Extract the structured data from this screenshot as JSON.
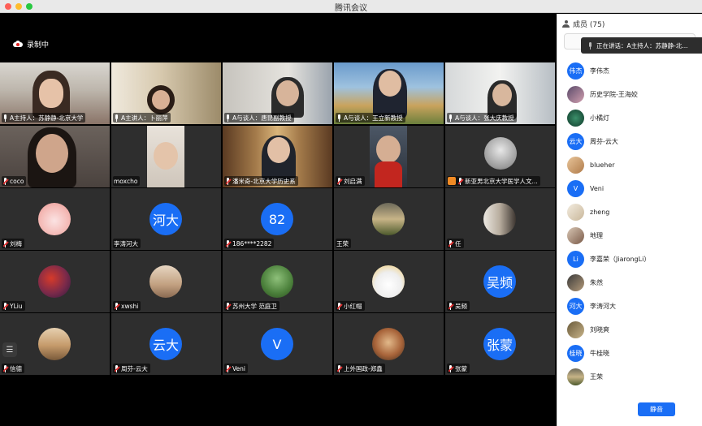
{
  "window": {
    "title": "腾讯会议"
  },
  "recording": {
    "label": "录制中"
  },
  "tiles": [
    {
      "label": "A主持人：苏静静-北京大学",
      "active": true
    },
    {
      "label": "A主讲人：卜丽萍"
    },
    {
      "label": "A与谈人：唐昆副教授"
    },
    {
      "label": "A与谈人：王立新教授"
    },
    {
      "label": "A与谈人：张大庆教授"
    },
    {
      "label": "coco"
    },
    {
      "label": "moxcho"
    },
    {
      "label": "潘米奇-北京大学历史系"
    },
    {
      "label": "刘启满"
    },
    {
      "label": "新亚男北京大学医学人文..."
    },
    {
      "label": "刘梅"
    },
    {
      "label": "李涛河大",
      "avatar_text": "河大"
    },
    {
      "label": "186****2282",
      "avatar_text": "82"
    },
    {
      "label": "王荣"
    },
    {
      "label": "任"
    },
    {
      "label": "YLiu"
    },
    {
      "label": "xwshi"
    },
    {
      "label": "苏州大学 范庭卫"
    },
    {
      "label": "小红帽"
    },
    {
      "label": "吴频",
      "avatar_text": "吴频"
    },
    {
      "label": "信德"
    },
    {
      "label": "周芬-云大",
      "avatar_text": "云大"
    },
    {
      "label": "Veni",
      "avatar_text": "V"
    },
    {
      "label": "上外国政-郑鑫"
    },
    {
      "label": "张蒙",
      "avatar_text": "张蒙"
    }
  ],
  "sidebar": {
    "title": "成员 (75)",
    "speaking": "正在讲话：A主持人：苏静静-北...",
    "members": [
      {
        "name": "李伟杰",
        "avatar": "伟杰"
      },
      {
        "name": "历史学院-王海姣",
        "avatar": ""
      },
      {
        "name": "小橘灯",
        "avatar": ""
      },
      {
        "name": "周芬-云大",
        "avatar": "云大"
      },
      {
        "name": "blueher",
        "avatar": ""
      },
      {
        "name": "Veni",
        "avatar": "V"
      },
      {
        "name": "zheng",
        "avatar": ""
      },
      {
        "name": "地理",
        "avatar": ""
      },
      {
        "name": "李嘉荣（JiarongLi）",
        "avatar": "Li"
      },
      {
        "name": "朱然",
        "avatar": ""
      },
      {
        "name": "李涛河大",
        "avatar": "河大"
      },
      {
        "name": "刘晓爽",
        "avatar": ""
      },
      {
        "name": "牛桂晓",
        "avatar": "桂晓"
      },
      {
        "name": "王荣",
        "avatar": ""
      }
    ],
    "mute_all_label": "静音"
  },
  "colors": {
    "accent": "#1a6ef5",
    "active_speaker": "#2ebd59"
  }
}
